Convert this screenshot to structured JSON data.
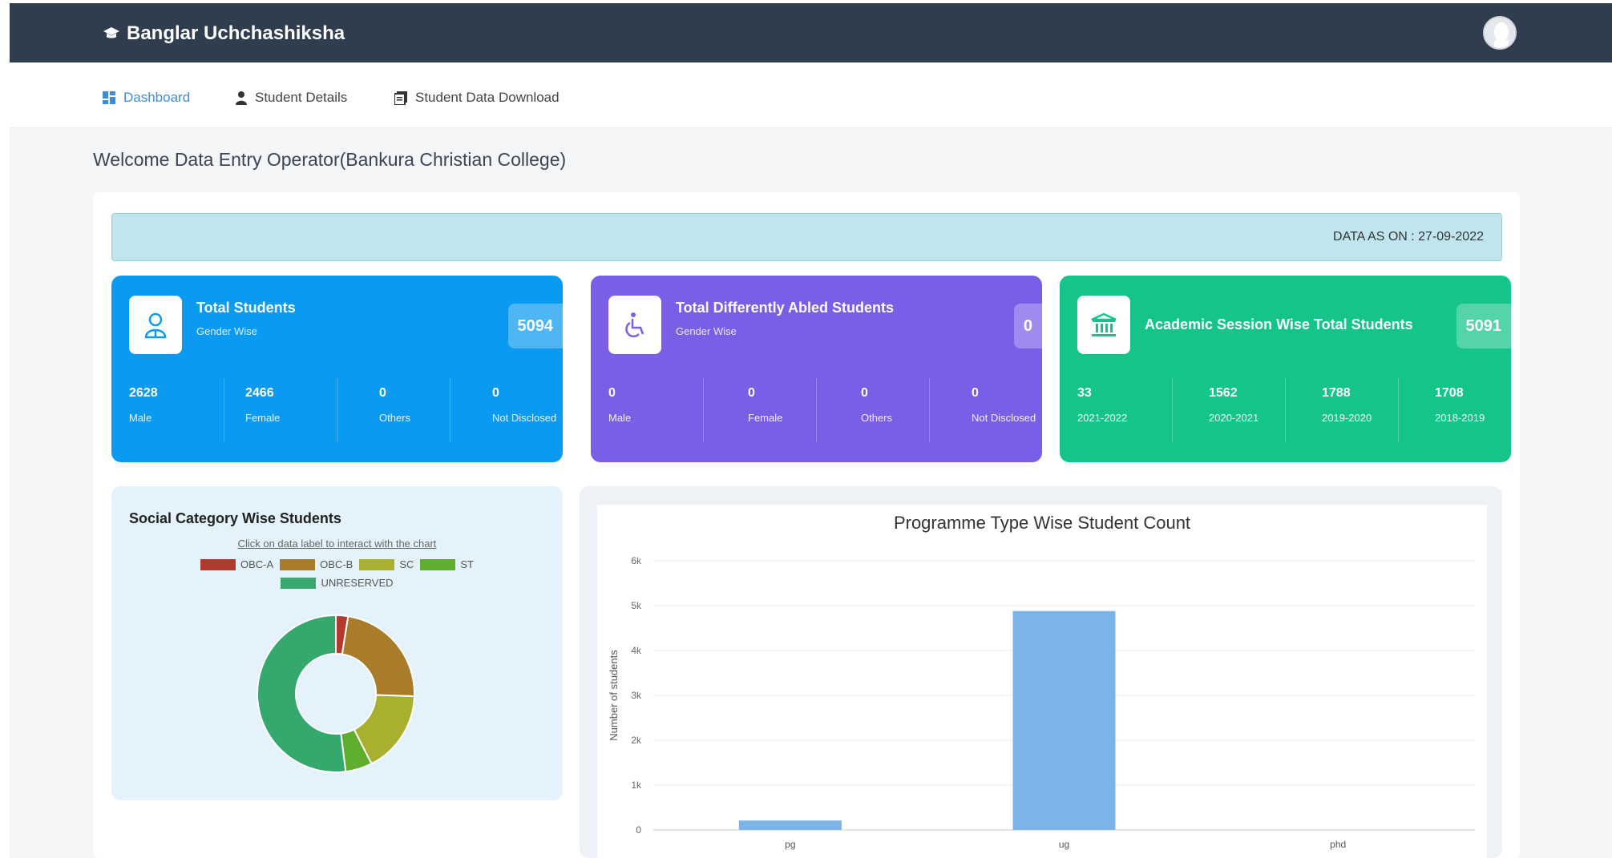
{
  "app": {
    "title": "Banglar Uchchashiksha"
  },
  "nav": {
    "items": [
      {
        "label": "Dashboard",
        "icon": "dashboard-icon",
        "active": true
      },
      {
        "label": "Student Details",
        "icon": "user-icon",
        "active": false
      },
      {
        "label": "Student Data Download",
        "icon": "document-icon",
        "active": false
      }
    ]
  },
  "welcome": "Welcome Data Entry Operator(Bankura Christian College)",
  "data_as_on": "DATA AS ON : 27-09-2022",
  "cards": [
    {
      "title": "Total Students",
      "subtitle": "Gender Wise",
      "total": "5094",
      "icon": "student-icon",
      "color": "#0b9af2",
      "stats": [
        {
          "value": "2628",
          "label": "Male"
        },
        {
          "value": "2466",
          "label": "Female"
        },
        {
          "value": "0",
          "label": "Others"
        },
        {
          "value": "0",
          "label": "Not Disclosed"
        }
      ]
    },
    {
      "title": "Total Differently Abled Students",
      "subtitle": "Gender Wise",
      "total": "0",
      "icon": "wheelchair-icon",
      "color": "#7b5ee6",
      "stats": [
        {
          "value": "0",
          "label": "Male"
        },
        {
          "value": "0",
          "label": "Female"
        },
        {
          "value": "0",
          "label": "Others"
        },
        {
          "value": "0",
          "label": "Not Disclosed"
        }
      ]
    },
    {
      "title": "Academic Session Wise Total Students",
      "subtitle": "",
      "total": "5091",
      "icon": "institution-icon",
      "color": "#14c48a",
      "stats": [
        {
          "value": "33",
          "label": "2021-2022"
        },
        {
          "value": "1562",
          "label": "2020-2021"
        },
        {
          "value": "1788",
          "label": "2019-2020"
        },
        {
          "value": "1708",
          "label": "2018-2019"
        }
      ]
    }
  ],
  "social": {
    "title": "Social Category Wise Students",
    "hint": "Click on data label to interact with the chart"
  },
  "chart_data": [
    {
      "type": "pie",
      "title": "Social Category Wise Students",
      "categories": [
        "OBC-A",
        "OBC-B",
        "SC",
        "ST",
        "UNRESERVED"
      ],
      "values": [
        2.5,
        23,
        17,
        5.5,
        52
      ],
      "colors": [
        "#b03a2e",
        "#a97c2a",
        "#a8b02e",
        "#5fae2e",
        "#35a86e"
      ],
      "legend": "top"
    },
    {
      "type": "bar",
      "title": "Programme Type Wise Student Count",
      "categories": [
        "pg",
        "ug",
        "phd"
      ],
      "values": [
        210,
        4880,
        0
      ],
      "ylabel": "Number of students",
      "xlabel": "",
      "ylim": [
        0,
        6000
      ],
      "yticks": [
        "0",
        "1k",
        "2k",
        "3k",
        "4k",
        "5k",
        "6k"
      ],
      "color": "#7cb4ea",
      "grid": true
    }
  ]
}
